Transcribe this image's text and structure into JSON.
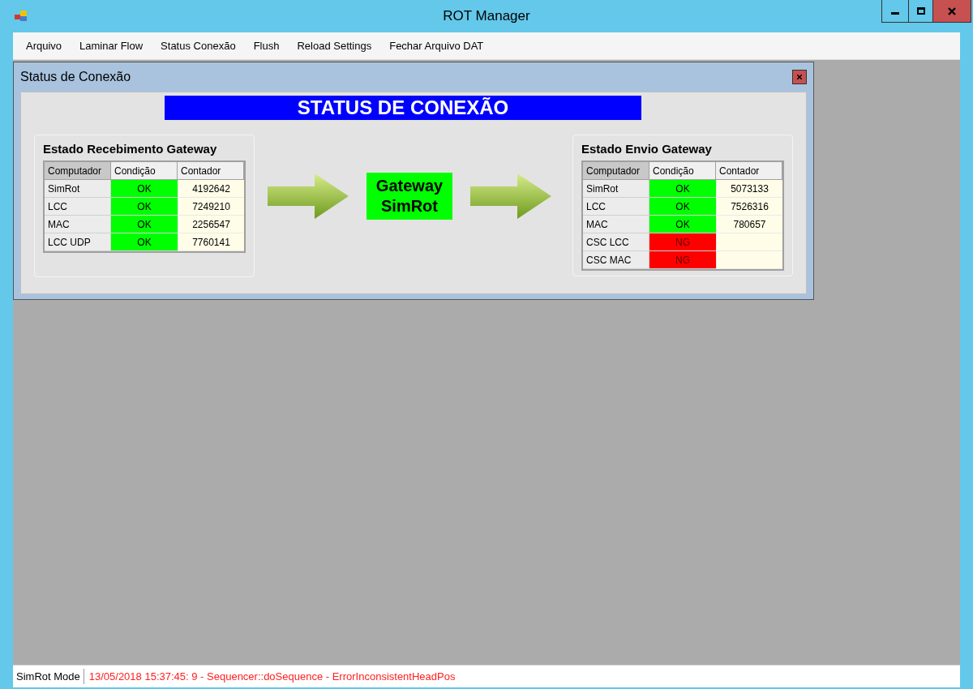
{
  "window": {
    "title": "ROT Manager"
  },
  "menu": [
    "Arquivo",
    "Laminar Flow",
    "Status Conexão",
    "Flush",
    "Reload Settings",
    "Fechar Arquivo DAT"
  ],
  "child_window": {
    "title": "Status de Conexão",
    "banner": "STATUS DE CONEXÃO",
    "gateway": "Gateway SimRot",
    "panels": [
      {
        "title": "Estado Recebimento Gateway",
        "columns": [
          "Computador",
          "Condição",
          "Contador"
        ],
        "rows": [
          {
            "computer": "SimRot",
            "condition": "OK",
            "ok": true,
            "counter": "4192642"
          },
          {
            "computer": "LCC",
            "condition": "OK",
            "ok": true,
            "counter": "7249210"
          },
          {
            "computer": "MAC",
            "condition": "OK",
            "ok": true,
            "counter": "2256547"
          },
          {
            "computer": "LCC UDP",
            "condition": "OK",
            "ok": true,
            "counter": "7760141"
          }
        ]
      },
      {
        "title": "Estado Envio Gateway",
        "columns": [
          "Computador",
          "Condição",
          "Contador"
        ],
        "rows": [
          {
            "computer": "SimRot",
            "condition": "OK",
            "ok": true,
            "counter": "5073133"
          },
          {
            "computer": "LCC",
            "condition": "OK",
            "ok": true,
            "counter": "7526316"
          },
          {
            "computer": "MAC",
            "condition": "OK",
            "ok": true,
            "counter": "780657"
          },
          {
            "computer": "CSC LCC",
            "condition": "NG",
            "ok": false
          },
          {
            "computer": "CSC MAC",
            "condition": "NG",
            "ok": false
          }
        ]
      }
    ]
  },
  "status_bar": {
    "mode": "SimRot Mode",
    "message": "13/05/2018 15:37:45: 9 - Sequencer::doSequence - ErrorInconsistentHeadPos"
  }
}
